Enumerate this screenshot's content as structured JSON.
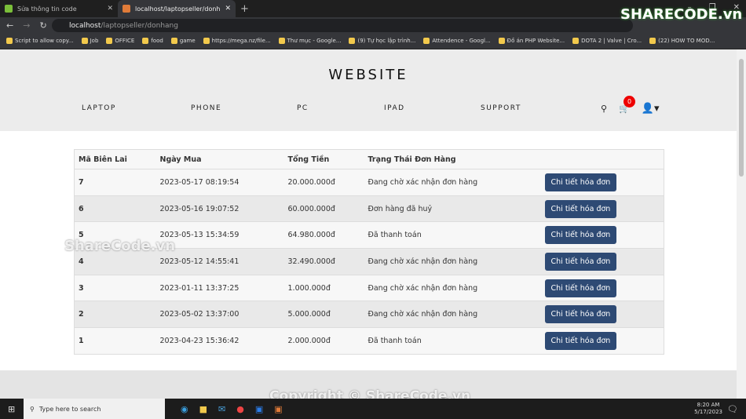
{
  "browser": {
    "tabs": [
      {
        "title": "Sửa thông tin code",
        "active": false
      },
      {
        "title": "localhost/laptopseller/donhang",
        "active": true
      }
    ],
    "url_host": "localhost",
    "url_path": "/laptopseller/donhang",
    "bookmarks": [
      "Script to allow copy...",
      "Job",
      "OFFICE",
      "food",
      "game",
      "https://mega.nz/file...",
      "Thư mục - Google...",
      "(9) Tự học lập trình...",
      "Attendence - Googl...",
      "Đồ án PHP Website...",
      "DOTA 2 | Valve | Cro...",
      "(22) HOW TO MOD..."
    ]
  },
  "site": {
    "brand": "WEBSITE",
    "nav": [
      "LAPTOP",
      "PHONE",
      "PC",
      "IPAD",
      "SUPPORT"
    ],
    "cart_count": "0"
  },
  "orders": {
    "headers": [
      "Mã Biên Lai",
      "Ngày Mua",
      "Tổng Tiền",
      "Trạng Thái Đơn Hàng"
    ],
    "button_label": "Chi tiết hóa đơn",
    "rows": [
      {
        "id": "7",
        "date": "2023-05-17 08:19:54",
        "total": "20.000.000đ",
        "status": "Đang chờ xác nhận đơn hàng"
      },
      {
        "id": "6",
        "date": "2023-05-16 19:07:52",
        "total": "60.000.000đ",
        "status": "Đơn hàng đã huỷ"
      },
      {
        "id": "5",
        "date": "2023-05-13 15:34:59",
        "total": "64.980.000đ",
        "status": "Đã thanh toán"
      },
      {
        "id": "4",
        "date": "2023-05-12 14:55:41",
        "total": "32.490.000đ",
        "status": "Đang chờ xác nhận đơn hàng"
      },
      {
        "id": "3",
        "date": "2023-01-11 13:37:25",
        "total": "1.000.000đ",
        "status": "Đang chờ xác nhận đơn hàng"
      },
      {
        "id": "2",
        "date": "2023-05-02 13:37:00",
        "total": "5.000.000đ",
        "status": "Đang chờ xác nhận đơn hàng"
      },
      {
        "id": "1",
        "date": "2023-04-23 15:36:42",
        "total": "2.000.000đ",
        "status": "Đã thanh toán"
      }
    ]
  },
  "watermark": {
    "logo": "SHARECODE.vn",
    "center": "ShareCode.vn",
    "copyright": "Copyright © ShareCode.vn"
  },
  "taskbar": {
    "search_placeholder": "Type here to search",
    "time": "8:20 AM",
    "date": "5/17/2023"
  }
}
